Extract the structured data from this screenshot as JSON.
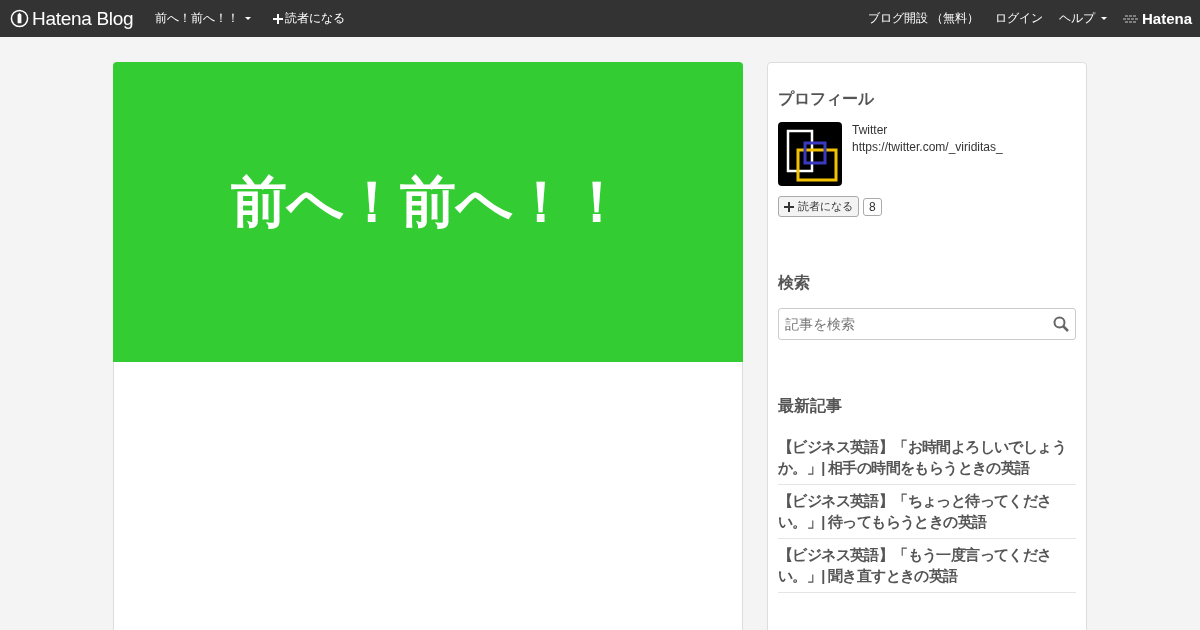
{
  "globalheader": {
    "logo": "Hatena Blog",
    "blog_menu": "前へ！前へ！！",
    "subscribe": "読者になる",
    "links": [
      "ブログ開設 （無料）",
      "ログイン"
    ],
    "help": "ヘルプ",
    "brand": "Hatena"
  },
  "blog": {
    "title": "前へ！前へ！！"
  },
  "sidebar": {
    "profile": {
      "heading": "プロフィール",
      "lines": [
        "Twitter",
        "https://twitter.com/_viriditas_"
      ],
      "subscribe": "読者になる",
      "count": "8"
    },
    "search": {
      "heading": "検索",
      "placeholder": "記事を検索"
    },
    "recent": {
      "heading": "最新記事",
      "entries": [
        "【ビジネス英語】「お時間よろしいでしょうか。」| 相手の時間をもらうときの英語",
        "【ビジネス英語】「ちょっと待ってください。」| 待ってもらうときの英語",
        "【ビジネス英語】「もう一度言ってください。」| 聞き直すときの英語"
      ]
    }
  }
}
